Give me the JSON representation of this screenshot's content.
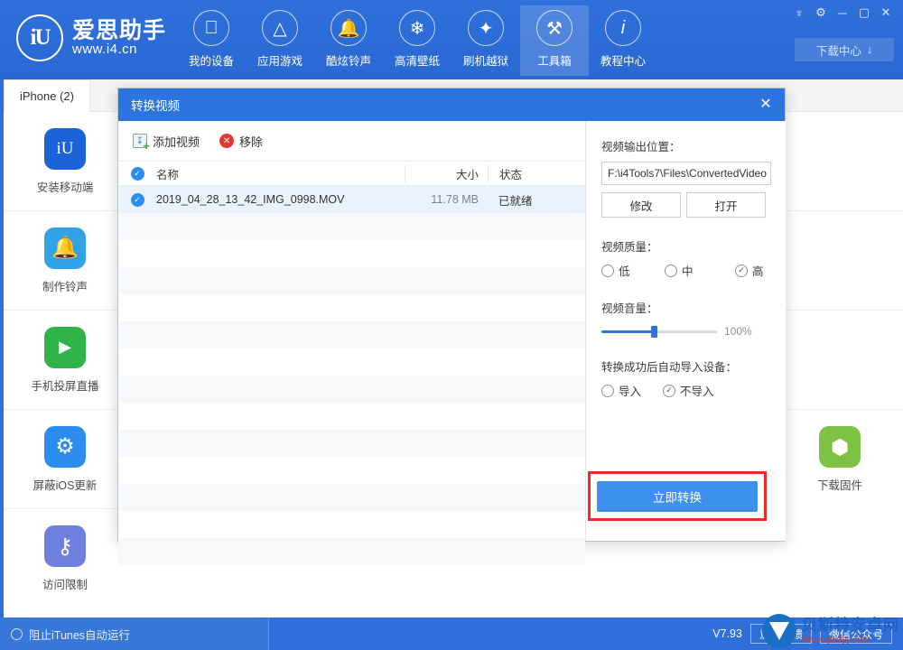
{
  "header": {
    "logo": {
      "mark": "iU",
      "name": "爱思助手",
      "url": "www.i4.cn"
    },
    "nav": [
      {
        "label": "我的设备",
        "icon": "apple-icon",
        "active": false
      },
      {
        "label": "应用游戏",
        "icon": "appstore-icon",
        "active": false
      },
      {
        "label": "酷炫铃声",
        "icon": "bell-icon",
        "active": false
      },
      {
        "label": "高清壁纸",
        "icon": "flower-icon",
        "active": false
      },
      {
        "label": "刷机越狱",
        "icon": "flash-icon",
        "active": false
      },
      {
        "label": "工具箱",
        "icon": "toolbox-icon",
        "active": true
      },
      {
        "label": "教程中心",
        "icon": "info-icon",
        "active": false
      }
    ],
    "window_controls": [
      {
        "name": "skin-icon",
        "glyph": "♆"
      },
      {
        "name": "settings-gear-icon",
        "glyph": "⚙"
      },
      {
        "name": "minimize-icon",
        "glyph": "─"
      },
      {
        "name": "maximize-icon",
        "glyph": "▢"
      },
      {
        "name": "close-icon",
        "glyph": "✕"
      }
    ],
    "download_center": {
      "label": "下载中心",
      "icon": "download-icon"
    }
  },
  "tabs": [
    {
      "label": "iPhone (2)"
    }
  ],
  "left_tools": [
    {
      "label": "安装移动端",
      "icon": "i4-app-icon",
      "glyph": "iU",
      "color": "#1a63d8"
    },
    {
      "label": "制作铃声",
      "icon": "ringtone-bell-icon",
      "glyph": "🔔",
      "color": "#32a2e8"
    },
    {
      "label": "手机投屏直播",
      "icon": "screen-cast-icon",
      "glyph": "▶",
      "color": "#2fb44a"
    },
    {
      "label": "屏蔽iOS更新",
      "icon": "block-ios-update-icon",
      "glyph": "⚙",
      "color": "#2d8cf0"
    },
    {
      "label": "访问限制",
      "icon": "access-restriction-key-icon",
      "glyph": "⚿",
      "color": "#6f7fe0"
    }
  ],
  "right_tools": [
    {
      "label": "下载固件",
      "icon": "firmware-box-icon",
      "glyph": "⬡",
      "color": "#7dc242"
    }
  ],
  "dialog": {
    "title": "转换视频",
    "close_icon": "close-icon",
    "toolbar": {
      "add_label": "添加视频",
      "remove_label": "移除"
    },
    "list": {
      "columns": {
        "name": "名称",
        "size": "大小",
        "status": "状态"
      },
      "rows": [
        {
          "checked": true,
          "name": "2019_04_28_13_42_IMG_0998.MOV",
          "size": "11.78 MB",
          "status": "已就绪"
        }
      ]
    },
    "settings": {
      "output_label": "视频输出位置：",
      "output_path": "F:\\i4Tools7\\Files\\ConvertedVideo",
      "modify_label": "修改",
      "open_label": "打开",
      "quality_label": "视频质量：",
      "quality_options": [
        {
          "label": "低",
          "selected": false
        },
        {
          "label": "中",
          "selected": false
        },
        {
          "label": "高",
          "selected": true
        }
      ],
      "volume_label": "视频音量：",
      "volume_percent": "100%",
      "volume_fill_ratio": 0.45,
      "autoimport_label": "转换成功后自动导入设备：",
      "autoimport_options": [
        {
          "label": "导入",
          "selected": false
        },
        {
          "label": "不导入",
          "selected": true
        }
      ],
      "convert_label": "立即转换",
      "convert_highlight_color": "#ee2b24"
    }
  },
  "statusbar": {
    "itunes_label": "阻止iTunes自动运行",
    "version": "V7.93",
    "feedback_label": "意见反馈",
    "wechat_label": "微信公众号"
  },
  "watermark": {
    "name": "贝斯特安卓网",
    "url": "www.zjbstyy.com"
  }
}
